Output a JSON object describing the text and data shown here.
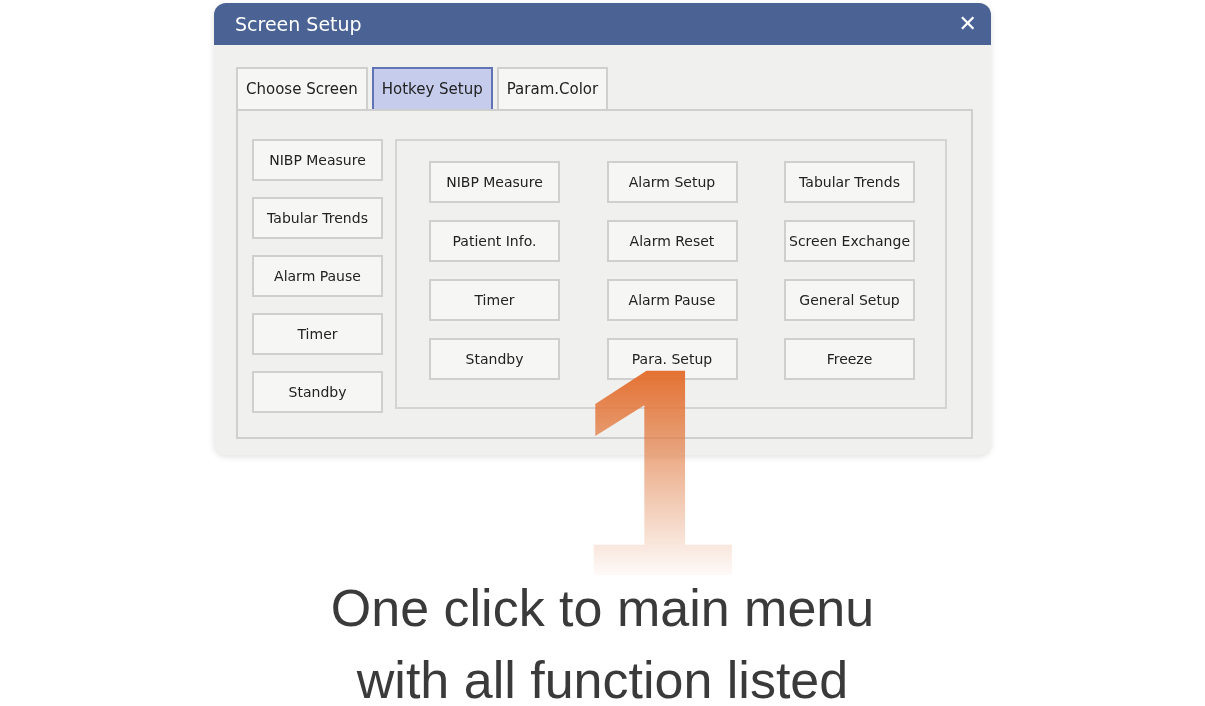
{
  "dialog": {
    "title": "Screen Setup",
    "close": "✕"
  },
  "tabs": [
    {
      "label": "Choose Screen",
      "selected": false
    },
    {
      "label": "Hotkey Setup",
      "selected": true
    },
    {
      "label": "Param.Color",
      "selected": false
    }
  ],
  "hotkeys": [
    "NIBP Measure",
    "Tabular Trends",
    "Alarm Pause",
    "Timer",
    "Standby"
  ],
  "functions": [
    "NIBP Measure",
    "Alarm Setup",
    "Tabular Trends",
    "Patient Info.",
    "Alarm Reset",
    "Screen Exchange",
    "Timer",
    "Alarm Pause",
    "General Setup",
    "Standby",
    "Para. Setup",
    "Freeze"
  ],
  "step_number": "1",
  "caption": [
    "One click to main menu",
    "with all function listed"
  ]
}
